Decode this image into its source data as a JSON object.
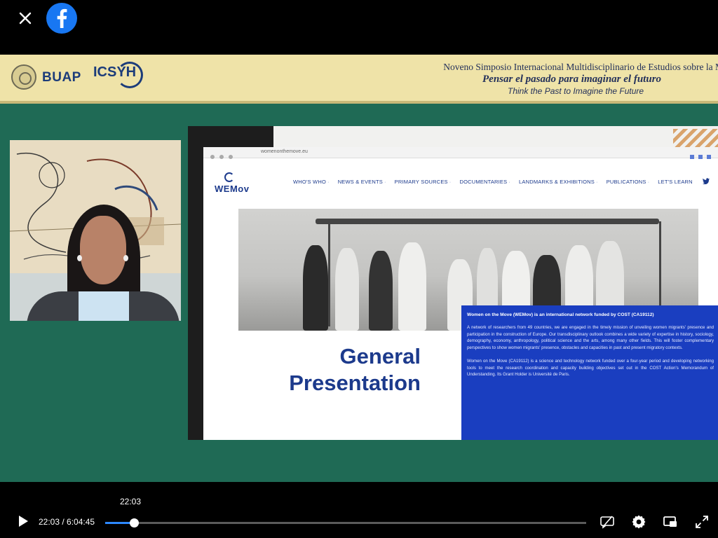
{
  "player": {
    "current_time_tooltip": "22:03",
    "time_display": "22:03 / 6:04:45",
    "progress_fraction": 0.0604,
    "accent": "#2d88ff"
  },
  "icons": {
    "close": "close-icon",
    "brand": "facebook-logo-icon",
    "play": "play-icon",
    "captions": "captions-off-icon",
    "settings": "gear-icon",
    "pip": "picture-in-picture-icon",
    "fullscreen": "fullscreen-icon"
  },
  "banner": {
    "logo_1": "BUAP",
    "logo_2": "ICSYH",
    "line_1": "Noveno Simposio Internacional Multidisciplinario de Estudios sobre la M",
    "line_2": "Pensar el pasado para imaginar el futuro",
    "line_3": "Think the Past to Imagine the Future"
  },
  "slide": {
    "url": "womenonthemove.eu",
    "site_logo": "WEMov",
    "nav": [
      "WHO'S WHO",
      "NEWS & EVENTS",
      "PRIMARY SOURCES",
      "DOCUMENTARIES",
      "LANDMARKS & EXHIBITIONS",
      "PUBLICATIONS",
      "LET'S LEARN"
    ],
    "heading_line_1": "General",
    "heading_line_2": "Presentation",
    "info_title": "Women on the Move (WEMov) is an international network funded by COST (CA19112)",
    "info_p1": "A network of researchers from 49 countries, we are engaged in the timely mission of unveiling women migrants' presence and participation in the construction of Europe. Our transdisciplinary outlook combines a wide variety of expertise in history, sociology, demography, economy, anthropology, political science and the arts, among many other fields. This will foster complementary perspectives to show women migrants' presence, obstacles and capacities in past and present migratory contexts.",
    "info_p2": "Women on the Move (CA19112) is a science and technology network funded over a four-year period and developing networking tools to meet the research coordination and capacity building objectives set out in the COST Action's Memorandum of Understanding. Its Grant Holder is Université de Paris."
  }
}
